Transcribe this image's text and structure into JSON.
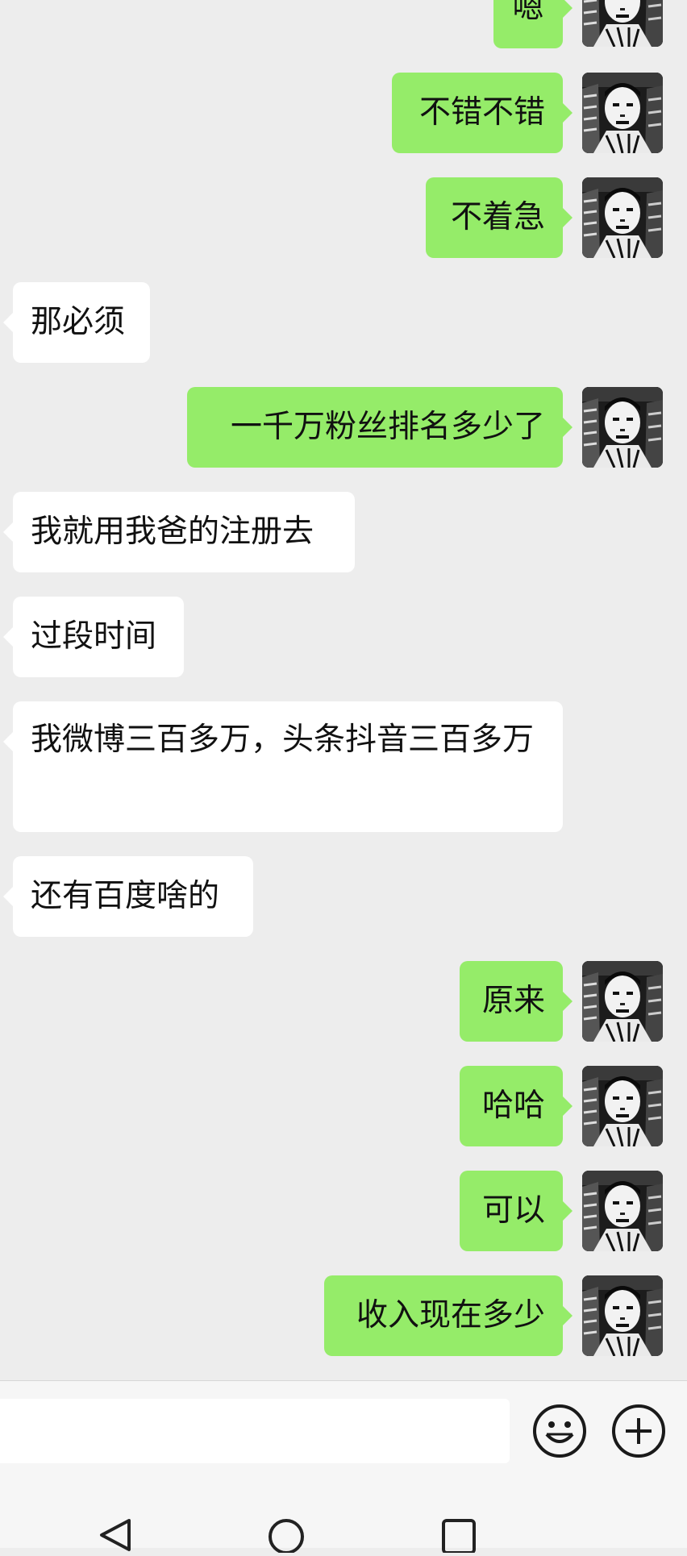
{
  "messages": [
    {
      "side": "out",
      "text": "嗯"
    },
    {
      "side": "out",
      "text": "不错不错"
    },
    {
      "side": "out",
      "text": "不着急"
    },
    {
      "side": "in",
      "text": "那必须"
    },
    {
      "side": "out",
      "text": "一千万粉丝排名多少了"
    },
    {
      "side": "in",
      "text": "我就用我爸的注册去"
    },
    {
      "side": "in",
      "text": "过段时间"
    },
    {
      "side": "in",
      "text": "我微博三百多万，头条抖音三百多万"
    },
    {
      "side": "in",
      "text": "还有百度啥的"
    },
    {
      "side": "out",
      "text": "原来"
    },
    {
      "side": "out",
      "text": "哈哈"
    },
    {
      "side": "out",
      "text": "可以"
    },
    {
      "side": "out",
      "text": "收入现在多少"
    }
  ],
  "input": {
    "value": ""
  },
  "icons": {
    "emoji": "emoji-icon",
    "more": "plus-circle-icon",
    "back": "nav-back-icon",
    "home": "nav-home-icon",
    "recents": "nav-recents-icon"
  },
  "colors": {
    "outgoing_bubble": "#95ec69",
    "incoming_bubble": "#ffffff",
    "background": "#ededed"
  }
}
